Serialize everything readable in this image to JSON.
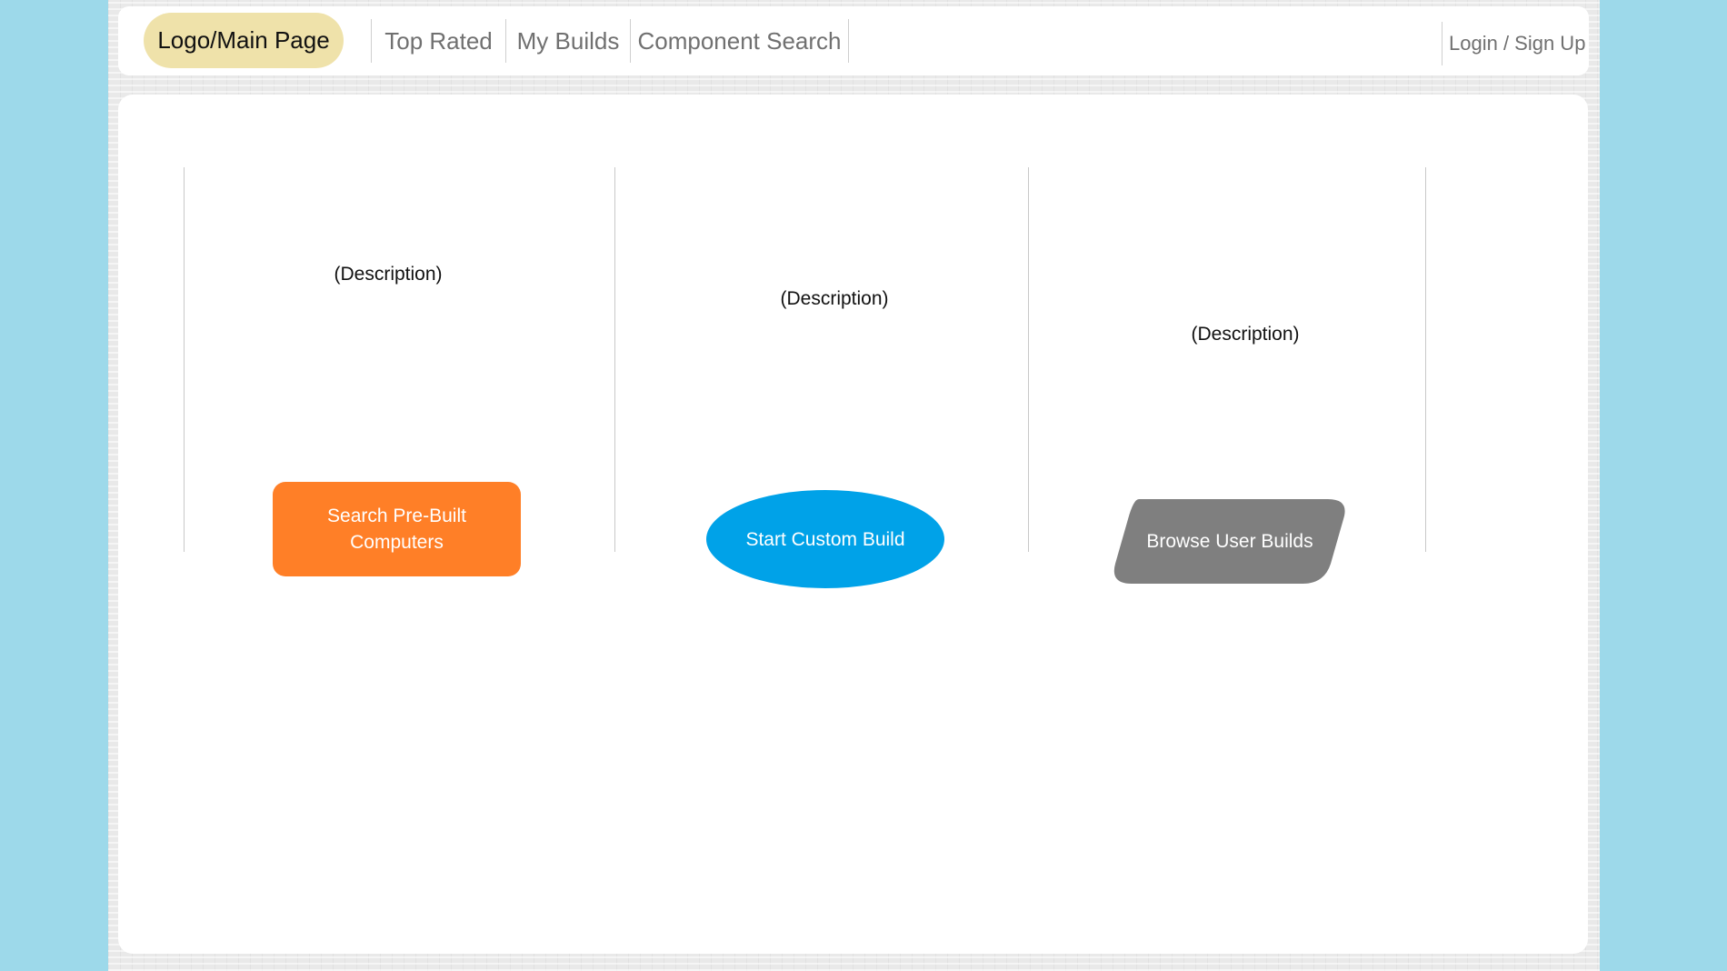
{
  "header": {
    "logo_label": "Logo/Main Page",
    "nav": [
      {
        "label": "Top Rated"
      },
      {
        "label": "My Builds"
      },
      {
        "label": "Component Search"
      }
    ],
    "login_label": "Login / Sign Up"
  },
  "main": {
    "columns": [
      {
        "description": "(Description)",
        "button_label": "Search Pre-Built Computers"
      },
      {
        "description": "(Description)",
        "button_label": "Start Custom Build"
      },
      {
        "description": "(Description)",
        "button_label": "Browse User Builds"
      }
    ]
  },
  "colors": {
    "page_background": "#9dd9ea",
    "logo_pill": "#efe2aa",
    "button_orange": "#ff7f27",
    "button_blue": "#00a2e8",
    "button_gray": "#7f7f7f"
  }
}
